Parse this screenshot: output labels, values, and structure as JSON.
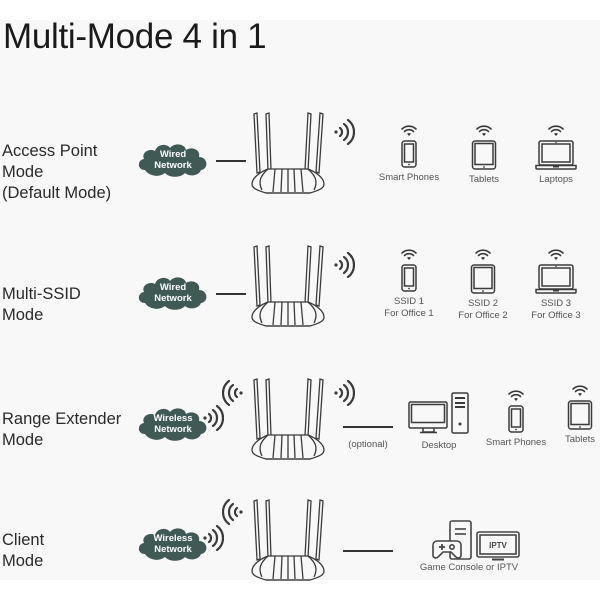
{
  "title": "Multi-Mode 4 in 1",
  "colors": {
    "cloud": "#3f5a55",
    "stroke": "#3a3a3a",
    "background": "#f8f8f8"
  },
  "modes": [
    {
      "label_lines": [
        "Access Point",
        "Mode",
        "(Default Mode)"
      ],
      "source": {
        "type": "cloud",
        "lines": [
          "Wired",
          "Network"
        ],
        "connection": "wired"
      },
      "router_signal": "wifi-out-icon",
      "devices": [
        {
          "icon": "smartphone-icon",
          "wifi": true,
          "lines": [
            "Smart Phones"
          ]
        },
        {
          "icon": "tablet-icon",
          "wifi": true,
          "lines": [
            "Tablets"
          ]
        },
        {
          "icon": "laptop-icon",
          "wifi": true,
          "lines": [
            "Laptops"
          ]
        }
      ]
    },
    {
      "label_lines": [
        "Multi-SSID",
        "Mode"
      ],
      "source": {
        "type": "cloud",
        "lines": [
          "Wired",
          "Network"
        ],
        "connection": "wired"
      },
      "router_signal": "wifi-out-icon",
      "devices": [
        {
          "icon": "smartphone-icon",
          "wifi": true,
          "lines": [
            "SSID 1",
            "For Office 1"
          ]
        },
        {
          "icon": "tablet-icon",
          "wifi": true,
          "lines": [
            "SSID 2",
            "For Office 2"
          ]
        },
        {
          "icon": "laptop-icon",
          "wifi": true,
          "lines": [
            "SSID 3",
            "For Office 3"
          ]
        }
      ]
    },
    {
      "label_lines": [
        "Range Extender",
        "Mode"
      ],
      "source": {
        "type": "cloud",
        "lines": [
          "Wireless",
          "Network"
        ],
        "connection": "wireless"
      },
      "router_signal": "wifi-out-icon",
      "optional_label": "(optional)",
      "devices": [
        {
          "icon": "desktop-icon",
          "wifi": false,
          "lines": [
            "Desktop"
          ]
        },
        {
          "icon": "smartphone-icon",
          "wifi": true,
          "lines": [
            "Smart Phones"
          ]
        },
        {
          "icon": "tablet-icon",
          "wifi": true,
          "lines": [
            "Tablets"
          ]
        }
      ]
    },
    {
      "label_lines": [
        "Client",
        "Mode"
      ],
      "source": {
        "type": "cloud",
        "lines": [
          "Wireless",
          "Network"
        ],
        "connection": "wireless"
      },
      "devices": [
        {
          "icon": "console-iptv-icon",
          "wifi": false,
          "lines": [
            "Game Console or IPTV"
          ],
          "screen_text": "IPTV"
        }
      ]
    }
  ]
}
